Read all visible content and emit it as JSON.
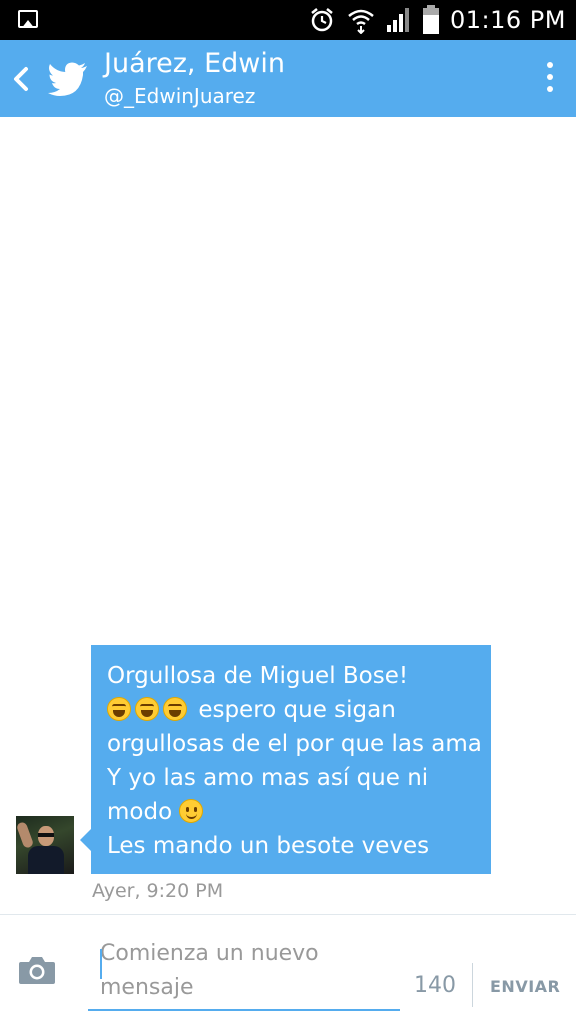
{
  "status_bar": {
    "time": "01:16 PM",
    "icons": [
      "gallery-icon",
      "alarm-icon",
      "wifi-icon",
      "signal-icon",
      "battery-icon"
    ]
  },
  "header": {
    "title": "Juárez, Edwin",
    "handle": "@_EdwinJuarez",
    "icons": [
      "back-icon",
      "twitter-bird-icon",
      "overflow-menu-icon"
    ]
  },
  "conversation": {
    "messages": [
      {
        "lines": [
          "Orgullosa de Miguel Bose!",
          "espero que sigan",
          "orgullosas de el por que las ama",
          "Y yo las amo mas así que ni",
          "modo",
          "Les mando un besote veves"
        ],
        "emoji": [
          "tears-of-joy-emoji",
          "tears-of-joy-emoji",
          "tears-of-joy-emoji",
          "slight-smile-emoji"
        ],
        "timestamp": "Ayer, 9:20 PM"
      }
    ]
  },
  "composer": {
    "placeholder": "Comienza un nuevo mensaje",
    "counter": "140",
    "send_label": "ENVIAR"
  },
  "colors": {
    "accent": "#55acee",
    "status_bar": "#000000",
    "muted_text": "#999999",
    "button_text": "#8899a6"
  }
}
